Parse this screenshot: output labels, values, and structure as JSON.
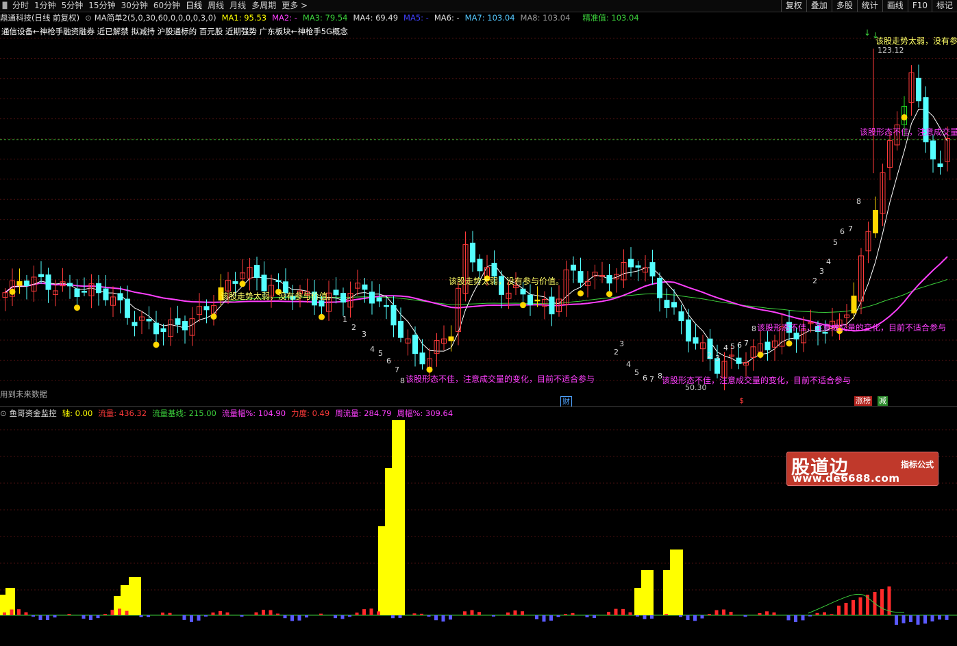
{
  "toolbar": {
    "icon": "panel-toggle-icon",
    "tabs": [
      "分时",
      "1分钟",
      "5分钟",
      "15分钟",
      "30分钟",
      "60分钟",
      "日线",
      "周线",
      "月线",
      "多周期",
      "更多 >"
    ],
    "active_tab": "日线",
    "right_buttons": [
      "复权",
      "叠加",
      "多股",
      "统计",
      "画线",
      "F10",
      "标记"
    ]
  },
  "ma_header": {
    "stock": "鼎通科技(日线 前复权)",
    "indicator": "MA简单2(5,0,30,60,0,0,0,0,3,0)",
    "ma1": "MA1: 95.53",
    "ma2": "MA2: -",
    "ma3": "MA3: 79.54",
    "ma4": "MA4: 69.49",
    "ma5": "MA5: -",
    "ma6": "MA6: -",
    "ma7": "MA7: 103.04",
    "ma8": "MA8: 103.04",
    "precise": "精准值: 103.04"
  },
  "concept_text": "通信设备←神枪手融资融券 近已解禁 拟减持 沪股通标的 百元股 近期强势 广东板块←神枪手5G概念",
  "future_text": "用到未来数据",
  "annotations": {
    "weak_trend": "该股走势太弱，没有参与价值。",
    "weak_trend_cut": "该股走势太弱，没有参",
    "bad_shape": "该股形态不佳，注意成交量的变化，目前不适合参与",
    "bad_shape_cut": "该股形态不佳，注意成交量",
    "high_price": "123.12",
    "low_price": "50.30"
  },
  "badges": {
    "cai": "财",
    "dollar": "$",
    "zhang": "涨榜",
    "jian": "减"
  },
  "indicator_header": {
    "name": "鱼哥资金监控",
    "axis": "轴: 0.00",
    "flow": "流量: 436.32",
    "baseline": "流量基线: 215.00",
    "flow_pct": "流量幅%: 104.90",
    "force": "力度: 0.49",
    "week_flow": "周流量: 284.79",
    "week_pct": "周幅%: 309.64"
  },
  "watermark": {
    "big": "股道边",
    "small": "指标公式",
    "url": "www.de6688.com"
  },
  "colors": {
    "up": "#ff3a3a",
    "down": "#54ffff",
    "ma5": "#ffffff",
    "ma30": "#ff40ff",
    "ma60": "#3cd23c",
    "signal_yellow": "#ffd700",
    "precise_line": "#3cc83c",
    "flow_yellow": "#ffff00",
    "flow_red": "#ff2a2a",
    "flow_blue": "#5a5aff"
  }
}
